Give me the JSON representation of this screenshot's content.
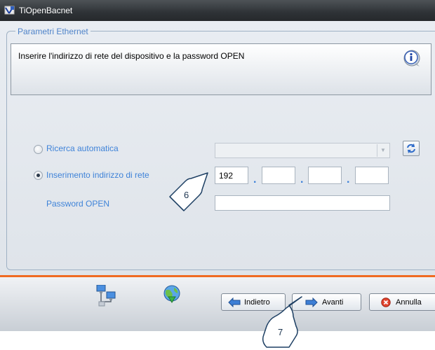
{
  "window": {
    "title": "TiOpenBacnet"
  },
  "group": {
    "legend": "Parametri Ethernet"
  },
  "info": {
    "text": "Inserire l'indirizzo di rete del dispositivo e la password OPEN"
  },
  "options": {
    "auto_search": {
      "label": "Ricerca automatica",
      "selected": false
    },
    "manual_address": {
      "label": "Inserimento indirizzo di rete",
      "selected": true
    }
  },
  "ip": {
    "octets": [
      "192",
      "",
      "",
      ""
    ],
    "separator": "."
  },
  "password": {
    "label": "Password OPEN",
    "value": ""
  },
  "buttons": {
    "back": "Indietro",
    "next": "Avanti",
    "cancel": "Annulla"
  },
  "callouts": {
    "step6": "6",
    "step7": "7"
  },
  "colors": {
    "accent": "#f06a22",
    "label_blue": "#3f83d8",
    "legend_blue": "#4f83c9"
  }
}
